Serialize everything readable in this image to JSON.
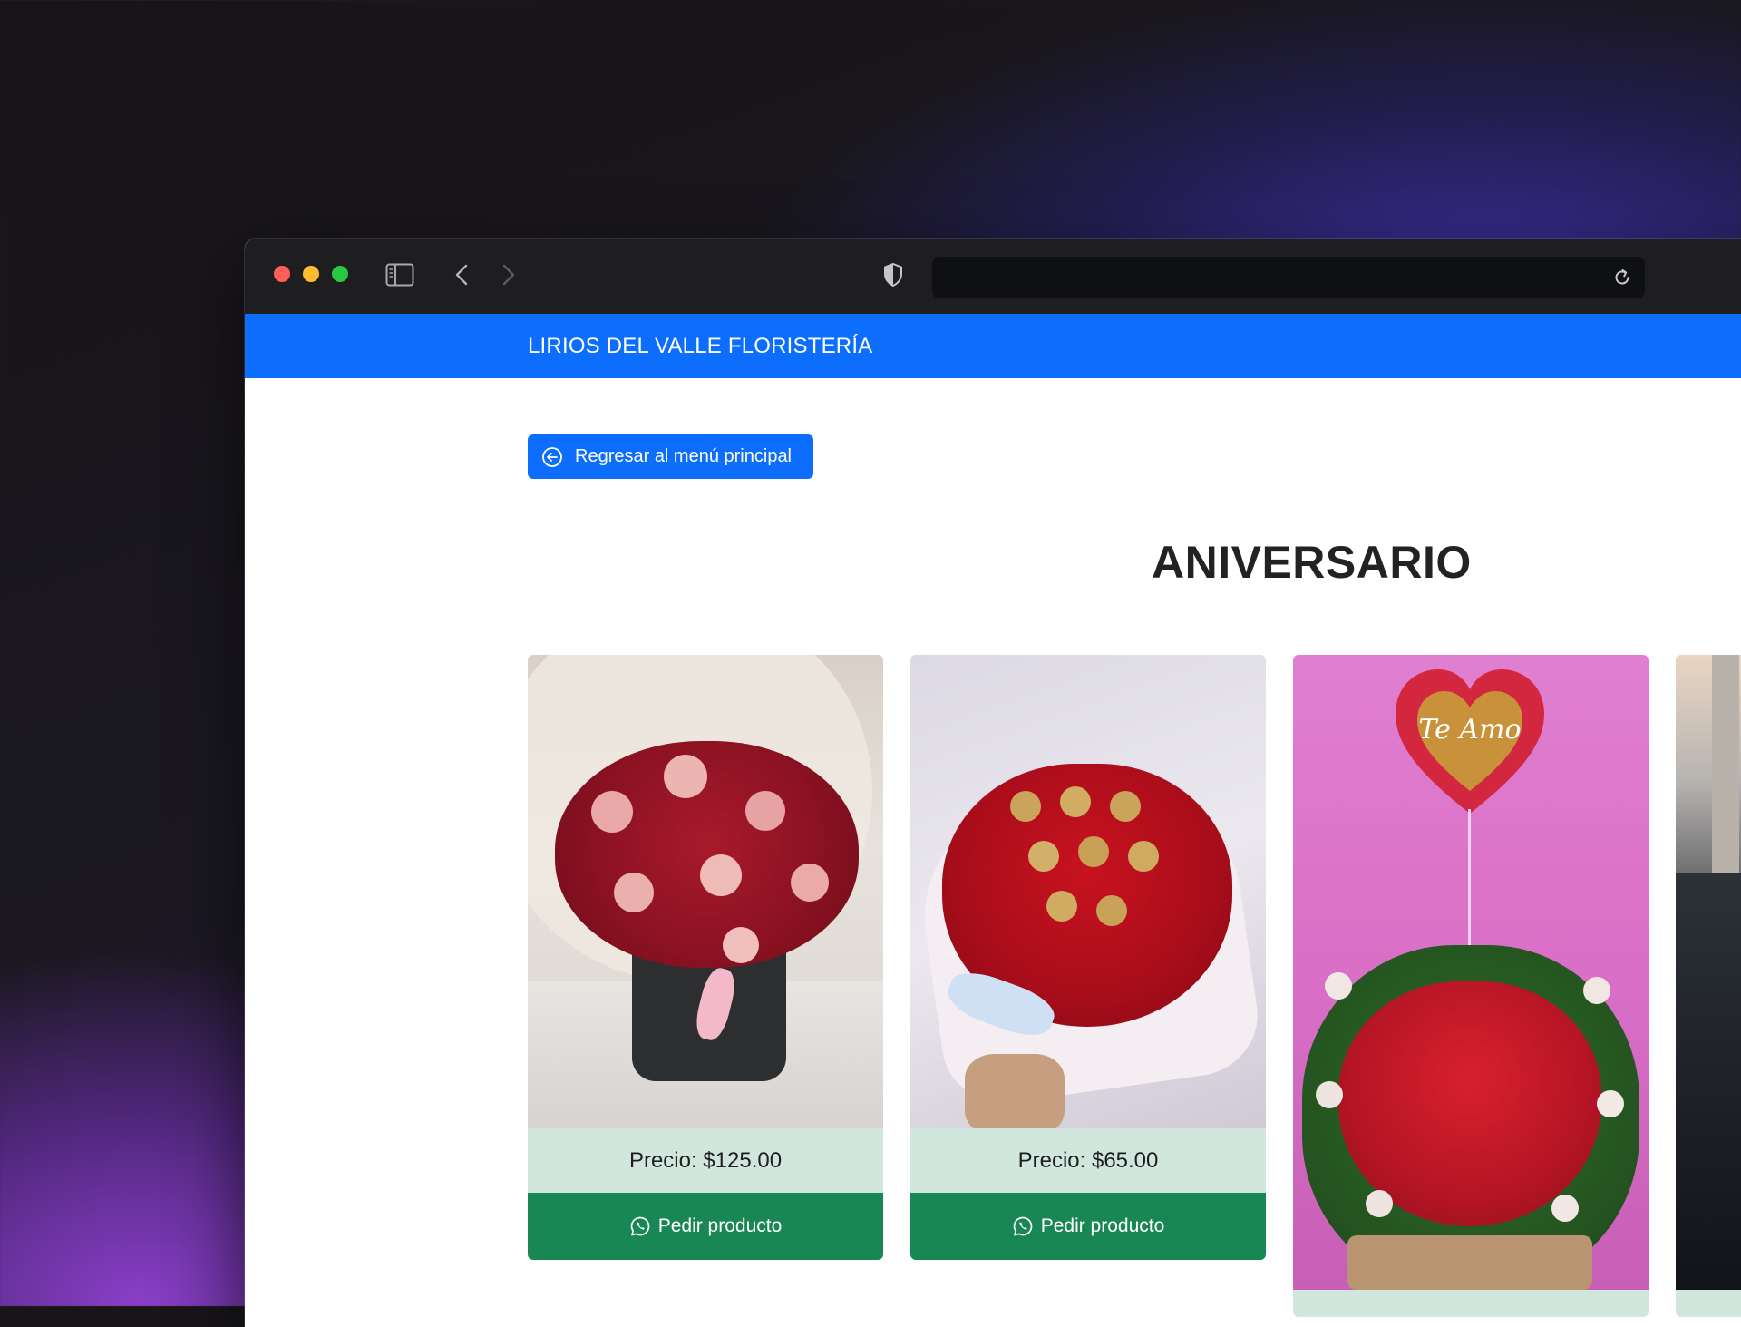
{
  "browser": {
    "icons": {
      "sidebar": "sidebar-toggle-icon",
      "back": "chevron-left-icon",
      "forward": "chevron-right-icon",
      "privacy": "shield-icon",
      "reload": "reload-icon"
    },
    "url": ""
  },
  "navbar": {
    "brand": "LIRIOS DEL VALLE FLORISTERÍA",
    "color": "#0d6efd"
  },
  "back_button": {
    "label": "Regresar al menú principal",
    "icon": "arrow-left-circle-icon"
  },
  "section": {
    "title": "ANIVERSARIO"
  },
  "products": [
    {
      "price": "Precio: $125.00",
      "order_label": "Pedir producto",
      "image": "bouquet-red-pink-roses-black-box"
    },
    {
      "price": "Precio: $65.00",
      "order_label": "Pedir producto",
      "image": "heart-box-red-roses-chocolates"
    },
    {
      "price": "",
      "order_label": "",
      "image": "heart-arrangement-red-roses-te-amo-balloon",
      "balloon_text": "Te Amo"
    },
    {
      "price": "",
      "order_label": "",
      "image": "partial-arrangement-outdoor"
    }
  ],
  "colors": {
    "primary": "#0d6efd",
    "success": "#198754",
    "price_bg": "#d1e7dd"
  }
}
